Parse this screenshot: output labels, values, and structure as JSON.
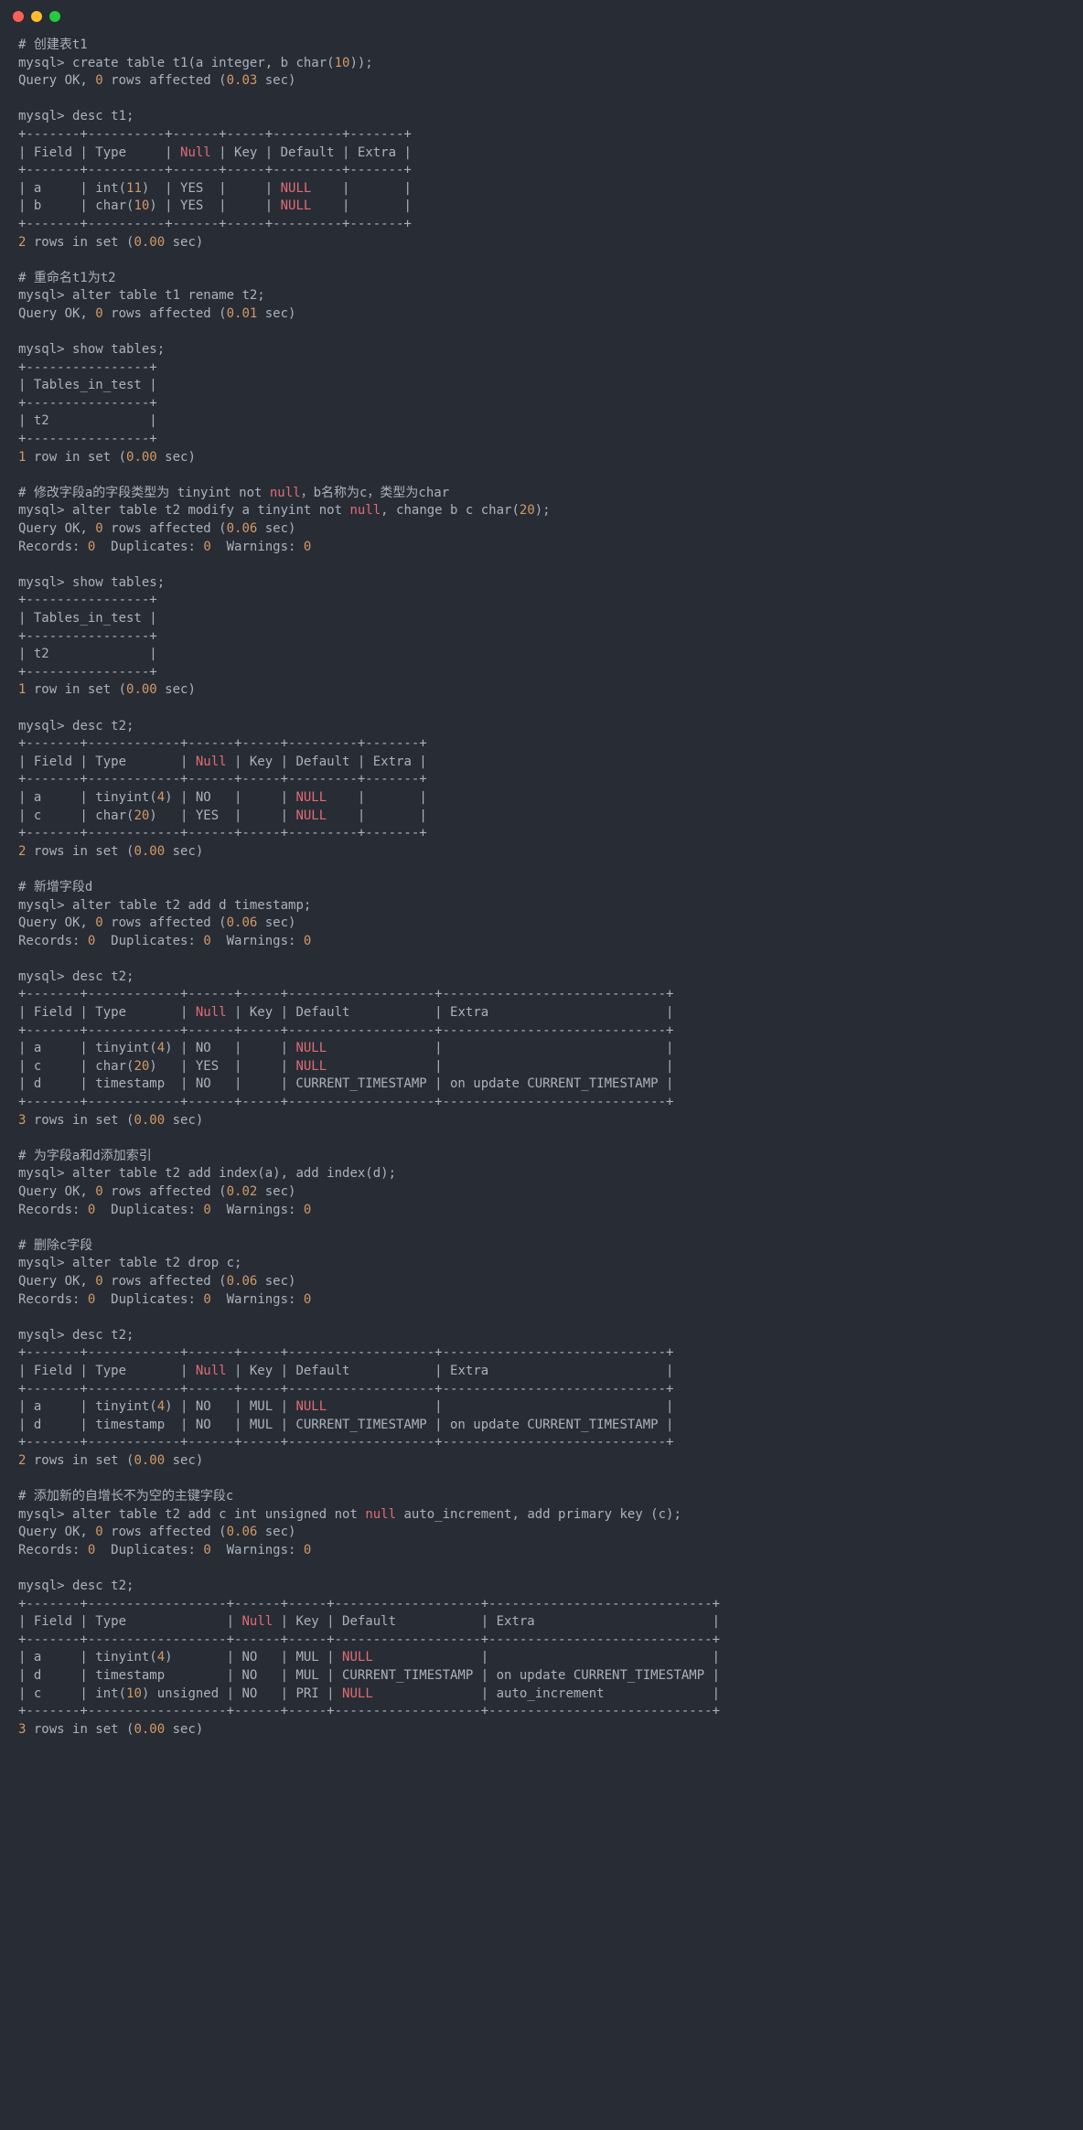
{
  "window": {
    "traffic_lights": [
      "red",
      "yellow",
      "green"
    ]
  },
  "lines": [
    {
      "t": "comment",
      "text": "# 创建表t1"
    },
    {
      "t": "cmd",
      "prompt": "mysql> ",
      "text": "create table t1(a integer, b char(",
      "num": "10",
      "text2": "));"
    },
    {
      "t": "result",
      "pre": "Query OK, ",
      "num": "0",
      "mid": " rows affected (",
      "num2": "0.03",
      "post": " sec)"
    },
    {
      "t": "blank"
    },
    {
      "t": "cmd",
      "prompt": "mysql> ",
      "text": "desc t1;"
    },
    {
      "t": "border",
      "text": "+-------+----------+------+-----+---------+-------+"
    },
    {
      "t": "header",
      "text": "| Field | Type     | ",
      "kw": "Null",
      "text2": " | Key | Default | Extra |"
    },
    {
      "t": "border",
      "text": "+-------+----------+------+-----+---------+-------+"
    },
    {
      "t": "row",
      "text": "| a     | int(",
      "num": "11",
      "text2": ")  | YES  |     | ",
      "kw": "NULL",
      "text3": "    |       |"
    },
    {
      "t": "row",
      "text": "| b     | char(",
      "num": "10",
      "text2": ") | YES  |     | ",
      "kw": "NULL",
      "text3": "    |       |"
    },
    {
      "t": "border",
      "text": "+-------+----------+------+-----+---------+-------+"
    },
    {
      "t": "result",
      "pre": "",
      "num": "2",
      "mid": " rows in set (",
      "num2": "0.00",
      "post": " sec)"
    },
    {
      "t": "blank"
    },
    {
      "t": "comment",
      "text": "# 重命名t1为t2"
    },
    {
      "t": "cmd",
      "prompt": "mysql> ",
      "text": "alter table t1 rename t2;"
    },
    {
      "t": "result",
      "pre": "Query OK, ",
      "num": "0",
      "mid": " rows affected (",
      "num2": "0.01",
      "post": " sec)"
    },
    {
      "t": "blank"
    },
    {
      "t": "cmd",
      "prompt": "mysql> ",
      "text": "show tables;"
    },
    {
      "t": "border",
      "text": "+----------------+"
    },
    {
      "t": "plain",
      "text": "| Tables_in_test |"
    },
    {
      "t": "border",
      "text": "+----------------+"
    },
    {
      "t": "plain",
      "text": "| t2             |"
    },
    {
      "t": "border",
      "text": "+----------------+"
    },
    {
      "t": "result",
      "pre": "",
      "num": "1",
      "mid": " row in set (",
      "num2": "0.00",
      "post": " sec)"
    },
    {
      "t": "blank"
    },
    {
      "t": "commentmix",
      "text": "# 修改字段a的字段类型为 tinyint not ",
      "kw": "null",
      "text2": "，b名称为c，类型为char"
    },
    {
      "t": "cmdlong",
      "prompt": "mysql> ",
      "text": "alter table t2 modify a tinyint not ",
      "kw": "null",
      "text2": ", change b c char(",
      "num": "20",
      "text3": ");"
    },
    {
      "t": "result",
      "pre": "Query OK, ",
      "num": "0",
      "mid": " rows affected (",
      "num2": "0.06",
      "post": " sec)"
    },
    {
      "t": "records",
      "pre": "Records: ",
      "num": "0",
      "mid": "  Duplicates: ",
      "num2": "0",
      "mid2": "  Warnings: ",
      "num3": "0"
    },
    {
      "t": "blank"
    },
    {
      "t": "cmd",
      "prompt": "mysql> ",
      "text": "show tables;"
    },
    {
      "t": "border",
      "text": "+----------------+"
    },
    {
      "t": "plain",
      "text": "| Tables_in_test |"
    },
    {
      "t": "border",
      "text": "+----------------+"
    },
    {
      "t": "plain",
      "text": "| t2             |"
    },
    {
      "t": "border",
      "text": "+----------------+"
    },
    {
      "t": "result",
      "pre": "",
      "num": "1",
      "mid": " row in set (",
      "num2": "0.00",
      "post": " sec)"
    },
    {
      "t": "blank"
    },
    {
      "t": "cmd",
      "prompt": "mysql> ",
      "text": "desc t2;"
    },
    {
      "t": "border",
      "text": "+-------+------------+------+-----+---------+-------+"
    },
    {
      "t": "header",
      "text": "| Field | Type       | ",
      "kw": "Null",
      "text2": " | Key | Default | Extra |"
    },
    {
      "t": "border",
      "text": "+-------+------------+------+-----+---------+-------+"
    },
    {
      "t": "row",
      "text": "| a     | tinyint(",
      "num": "4",
      "text2": ") | NO   |     | ",
      "kw": "NULL",
      "text3": "    |       |"
    },
    {
      "t": "row",
      "text": "| c     | char(",
      "num": "20",
      "text2": ")   | YES  |     | ",
      "kw": "NULL",
      "text3": "    |       |"
    },
    {
      "t": "border",
      "text": "+-------+------------+------+-----+---------+-------+"
    },
    {
      "t": "result",
      "pre": "",
      "num": "2",
      "mid": " rows in set (",
      "num2": "0.00",
      "post": " sec)"
    },
    {
      "t": "blank"
    },
    {
      "t": "comment",
      "text": "# 新增字段d"
    },
    {
      "t": "cmd",
      "prompt": "mysql> ",
      "text": "alter table t2 add d timestamp;"
    },
    {
      "t": "result",
      "pre": "Query OK, ",
      "num": "0",
      "mid": " rows affected (",
      "num2": "0.06",
      "post": " sec)"
    },
    {
      "t": "records",
      "pre": "Records: ",
      "num": "0",
      "mid": "  Duplicates: ",
      "num2": "0",
      "mid2": "  Warnings: ",
      "num3": "0"
    },
    {
      "t": "blank"
    },
    {
      "t": "cmd",
      "prompt": "mysql> ",
      "text": "desc t2;"
    },
    {
      "t": "border",
      "text": "+-------+------------+------+-----+-------------------+-----------------------------+"
    },
    {
      "t": "header",
      "text": "| Field | Type       | ",
      "kw": "Null",
      "text2": " | Key | Default           | Extra                       |"
    },
    {
      "t": "border",
      "text": "+-------+------------+------+-----+-------------------+-----------------------------+"
    },
    {
      "t": "row",
      "text": "| a     | tinyint(",
      "num": "4",
      "text2": ") | NO   |     | ",
      "kw": "NULL",
      "text3": "              |                             |"
    },
    {
      "t": "row",
      "text": "| c     | char(",
      "num": "20",
      "text2": ")   | YES  |     | ",
      "kw": "NULL",
      "text3": "              |                             |"
    },
    {
      "t": "plain",
      "text": "| d     | timestamp  | NO   |     | CURRENT_TIMESTAMP | on update CURRENT_TIMESTAMP |"
    },
    {
      "t": "border",
      "text": "+-------+------------+------+-----+-------------------+-----------------------------+"
    },
    {
      "t": "result",
      "pre": "",
      "num": "3",
      "mid": " rows in set (",
      "num2": "0.00",
      "post": " sec)"
    },
    {
      "t": "blank"
    },
    {
      "t": "comment",
      "text": "# 为字段a和d添加索引"
    },
    {
      "t": "cmd",
      "prompt": "mysql> ",
      "text": "alter table t2 add index(a), add index(d);"
    },
    {
      "t": "result",
      "pre": "Query OK, ",
      "num": "0",
      "mid": " rows affected (",
      "num2": "0.02",
      "post": " sec)"
    },
    {
      "t": "records",
      "pre": "Records: ",
      "num": "0",
      "mid": "  Duplicates: ",
      "num2": "0",
      "mid2": "  Warnings: ",
      "num3": "0"
    },
    {
      "t": "blank"
    },
    {
      "t": "comment",
      "text": "# 删除c字段"
    },
    {
      "t": "cmd",
      "prompt": "mysql> ",
      "text": "alter table t2 drop c;"
    },
    {
      "t": "result",
      "pre": "Query OK, ",
      "num": "0",
      "mid": " rows affected (",
      "num2": "0.06",
      "post": " sec)"
    },
    {
      "t": "records",
      "pre": "Records: ",
      "num": "0",
      "mid": "  Duplicates: ",
      "num2": "0",
      "mid2": "  Warnings: ",
      "num3": "0"
    },
    {
      "t": "blank"
    },
    {
      "t": "cmd",
      "prompt": "mysql> ",
      "text": "desc t2;"
    },
    {
      "t": "border",
      "text": "+-------+------------+------+-----+-------------------+-----------------------------+"
    },
    {
      "t": "header",
      "text": "| Field | Type       | ",
      "kw": "Null",
      "text2": " | Key | Default           | Extra                       |"
    },
    {
      "t": "border",
      "text": "+-------+------------+------+-----+-------------------+-----------------------------+"
    },
    {
      "t": "row",
      "text": "| a     | tinyint(",
      "num": "4",
      "text2": ") | NO   | MUL | ",
      "kw": "NULL",
      "text3": "              |                             |"
    },
    {
      "t": "plain",
      "text": "| d     | timestamp  | NO   | MUL | CURRENT_TIMESTAMP | on update CURRENT_TIMESTAMP |"
    },
    {
      "t": "border",
      "text": "+-------+------------+------+-----+-------------------+-----------------------------+"
    },
    {
      "t": "result",
      "pre": "",
      "num": "2",
      "mid": " rows in set (",
      "num2": "0.00",
      "post": " sec)"
    },
    {
      "t": "blank"
    },
    {
      "t": "comment",
      "text": "# 添加新的自增长不为空的主键字段c"
    },
    {
      "t": "cmdlong",
      "prompt": "mysql> ",
      "text": "alter table t2 add c int unsigned not ",
      "kw": "null",
      "text2": " auto_increment, add primary key (c);"
    },
    {
      "t": "result",
      "pre": "Query OK, ",
      "num": "0",
      "mid": " rows affected (",
      "num2": "0.06",
      "post": " sec)"
    },
    {
      "t": "records",
      "pre": "Records: ",
      "num": "0",
      "mid": "  Duplicates: ",
      "num2": "0",
      "mid2": "  Warnings: ",
      "num3": "0"
    },
    {
      "t": "blank"
    },
    {
      "t": "cmd",
      "prompt": "mysql> ",
      "text": "desc t2;"
    },
    {
      "t": "border",
      "text": "+-------+------------------+------+-----+-------------------+-----------------------------+"
    },
    {
      "t": "header",
      "text": "| Field | Type             | ",
      "kw": "Null",
      "text2": " | Key | Default           | Extra                       |"
    },
    {
      "t": "border",
      "text": "+-------+------------------+------+-----+-------------------+-----------------------------+"
    },
    {
      "t": "row",
      "text": "| a     | tinyint(",
      "num": "4",
      "text2": ")       | NO   | MUL | ",
      "kw": "NULL",
      "text3": "              |                             |"
    },
    {
      "t": "plain",
      "text": "| d     | timestamp        | NO   | MUL | CURRENT_TIMESTAMP | on update CURRENT_TIMESTAMP |"
    },
    {
      "t": "row",
      "text": "| c     | int(",
      "num": "10",
      "text2": ") unsigned | NO   | PRI | ",
      "kw": "NULL",
      "text3": "              | auto_increment              |"
    },
    {
      "t": "border",
      "text": "+-------+------------------+------+-----+-------------------+-----------------------------+"
    },
    {
      "t": "result",
      "pre": "",
      "num": "3",
      "mid": " rows in set (",
      "num2": "0.00",
      "post": " sec)"
    }
  ]
}
